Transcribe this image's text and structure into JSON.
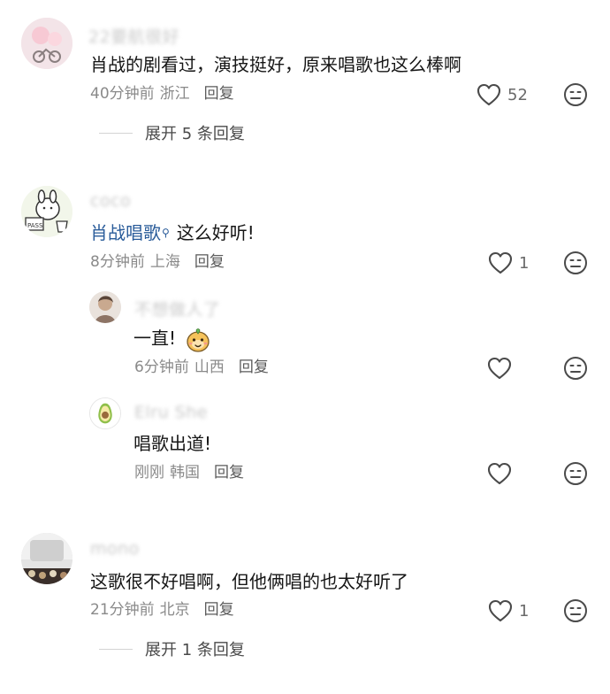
{
  "comments": [
    {
      "username": "22要航很好",
      "text": "肖战的剧看过，演技挺好，原来唱歌也这么棒啊",
      "time": "40分钟前",
      "location": "浙江",
      "reply": "回复",
      "likes": "52",
      "expand": "展开 5 条回复"
    },
    {
      "username": "coco",
      "mention": "肖战唱歌",
      "text": "这么好听!",
      "time": "8分钟前",
      "location": "上海",
      "reply": "回复",
      "likes": "1",
      "replies": [
        {
          "username": "不想做人了",
          "text": "一直!",
          "time": "6分钟前",
          "location": "山西",
          "reply": "回复"
        },
        {
          "username": "Elru She",
          "text": "唱歌出道!",
          "time": "刚刚",
          "location": "韩国",
          "reply": "回复"
        }
      ]
    },
    {
      "username": "mono",
      "text": "这歌很不好唱啊，但他俩唱的也太好听了",
      "time": "21分钟前",
      "location": "北京",
      "reply": "回复",
      "likes": "1",
      "expand": "展开 1 条回复"
    }
  ],
  "icons": {
    "like": "heart-outline-icon",
    "dislike": "neutral-face-icon",
    "search": "search-icon",
    "emoji": "cartoon-face-emoji"
  },
  "colors": {
    "mention": "#2a5c9a",
    "meta": "#8a8a8a",
    "text": "#161616"
  }
}
